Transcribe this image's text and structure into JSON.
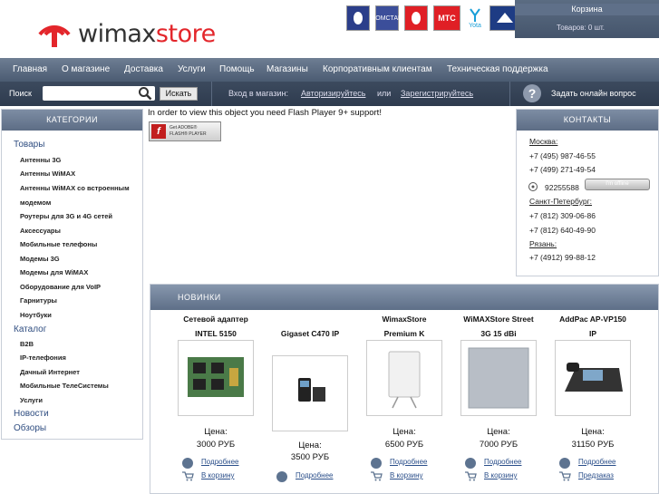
{
  "header": {
    "logo_text_a": "wimax",
    "logo_text_b": "store",
    "partners": [
      {
        "name": "megafon-icon",
        "label": ""
      },
      {
        "name": "komstar-small-icon",
        "label": "КОМСТАР"
      },
      {
        "name": "mts-egg-icon",
        "label": ""
      },
      {
        "name": "mts-icon",
        "label": "МТС"
      },
      {
        "name": "yota-icon",
        "label": "Yota"
      },
      {
        "name": "komstar-icon",
        "label": ""
      }
    ],
    "cart": {
      "title": "Корзина",
      "goods": "Товаров: 0 шт."
    }
  },
  "nav": {
    "items": [
      "Главная",
      "О магазине",
      "Доставка",
      "Услуги",
      "Помощь",
      "Магазины",
      "Корпоративным клиентам",
      "Техническая поддержка"
    ]
  },
  "search": {
    "label": "Поиск",
    "value": "",
    "button": "Искать",
    "login_label": "Вход в магазин:",
    "login_link": "Авторизируйтесь",
    "or": "или",
    "register_link": "Зарегистрируйтесь",
    "ask": "Задать онлайн вопрос"
  },
  "sidebar": {
    "title": "КАТЕГОРИИ",
    "top1": "Товары",
    "goods": [
      "Антенны 3G",
      "Антенны WiMAX",
      "Антенны WiMAX со встроенным",
      "модемом",
      "Роутеры для 3G и 4G сетей",
      "Аксессуары",
      "Мобильные телефоны",
      "Модемы 3G",
      "Модемы для WiMAX",
      "Оборудование для VoIP",
      "Гарнитуры",
      "Ноутбуки"
    ],
    "top2": "Каталог",
    "catalog": [
      "B2B",
      "IP-телефония",
      "Дачный Интернет",
      "Мобильные ТелеСистемы",
      "Услуги"
    ],
    "top3": "Новости",
    "top4": "Обзоры"
  },
  "flash": {
    "text": "In order to view this object you need Flash Player 9+ support!",
    "badge_line1": "Get ADOBE®",
    "badge_line2": "FLASH® PLAYER"
  },
  "contacts": {
    "title": "КОНТАКТЫ",
    "moscow": "Москва:",
    "m_phone1": "+7 (495) 987-46-55",
    "m_phone2": "+7 (499) 271-49-54",
    "icq": "92255588",
    "icq_status": "I'm offline",
    "spb": "Санкт-Петербург:",
    "s_phone1": "+7 (812) 309-06-86",
    "s_phone2": "+7 (812) 640-49-90",
    "ryazan": "Рязань:",
    "r_phone1": "+7 (4912) 99-88-12"
  },
  "news": {
    "title": "НОВИНКИ",
    "price_label": "Цена:",
    "products": [
      {
        "name1": "Сетевой адаптер",
        "name2": "INTEL 5150",
        "price": "3000 РУБ",
        "more": "Подробнее",
        "action": "В корзину"
      },
      {
        "name1": "Gigaset C470 IP",
        "name2": "",
        "price": "3500 РУБ",
        "more": "Подробнее",
        "action": ""
      },
      {
        "name1": "WimaxStore",
        "name2": "Premium K",
        "price": "6500 РУБ",
        "more": "Подробнее",
        "action": "В корзину"
      },
      {
        "name1": "WiMAXStore Street",
        "name2": "3G 15 dBi",
        "price": "7000 РУБ",
        "more": "Подробнее",
        "action": "В корзину"
      },
      {
        "name1": "AddPac AP-VP150",
        "name2": "IP",
        "price": "31150 РУБ",
        "more": "Подробнее",
        "action": "Предзаказ"
      }
    ]
  },
  "colors": {
    "accent": "#e3262b",
    "nav": "#5b6b82",
    "link": "#2b4f8a"
  }
}
